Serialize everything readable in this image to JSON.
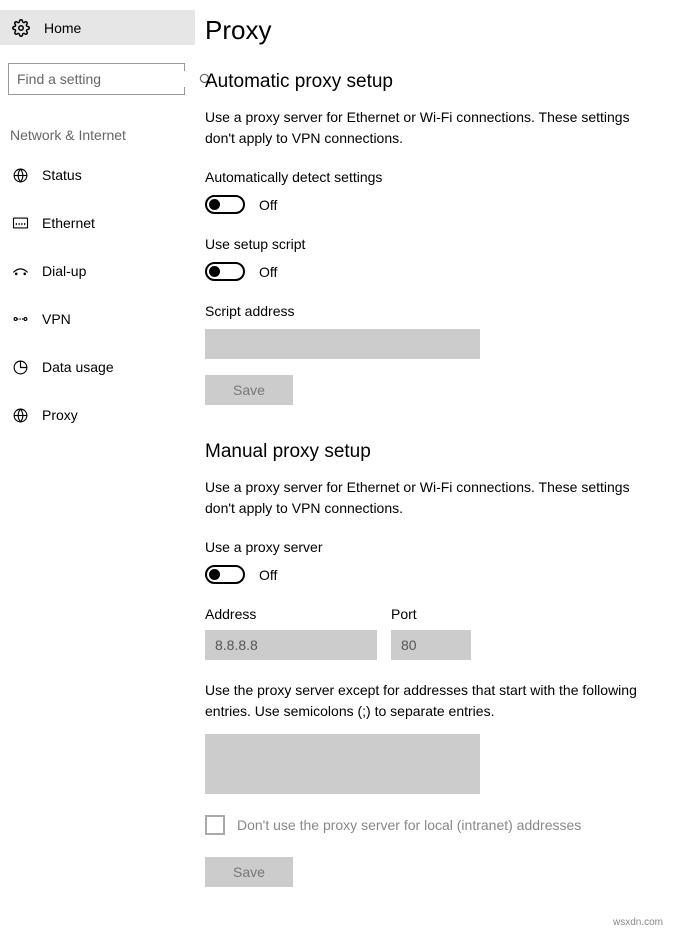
{
  "sidebar": {
    "home": "Home",
    "search_placeholder": "Find a setting",
    "category": "Network & Internet",
    "items": [
      {
        "label": "Status"
      },
      {
        "label": "Ethernet"
      },
      {
        "label": "Dial-up"
      },
      {
        "label": "VPN"
      },
      {
        "label": "Data usage"
      },
      {
        "label": "Proxy"
      }
    ]
  },
  "main": {
    "title": "Proxy",
    "auto": {
      "heading": "Automatic proxy setup",
      "desc": "Use a proxy server for Ethernet or Wi-Fi connections. These settings don't apply to VPN connections.",
      "detect_label": "Automatically detect settings",
      "detect_state": "Off",
      "script_label": "Use setup script",
      "script_state": "Off",
      "script_addr_label": "Script address",
      "script_addr_value": "",
      "save": "Save"
    },
    "manual": {
      "heading": "Manual proxy setup",
      "desc": "Use a proxy server for Ethernet or Wi-Fi connections. These settings don't apply to VPN connections.",
      "use_label": "Use a proxy server",
      "use_state": "Off",
      "address_label": "Address",
      "address_value": "8.8.8.8",
      "port_label": "Port",
      "port_value": "80",
      "except_desc": "Use the proxy server except for addresses that start with the following entries. Use semicolons (;) to separate entries.",
      "except_value": "",
      "bypass_local": "Don't use the proxy server for local (intranet) addresses",
      "save": "Save"
    }
  },
  "watermark": "wsxdn.com"
}
